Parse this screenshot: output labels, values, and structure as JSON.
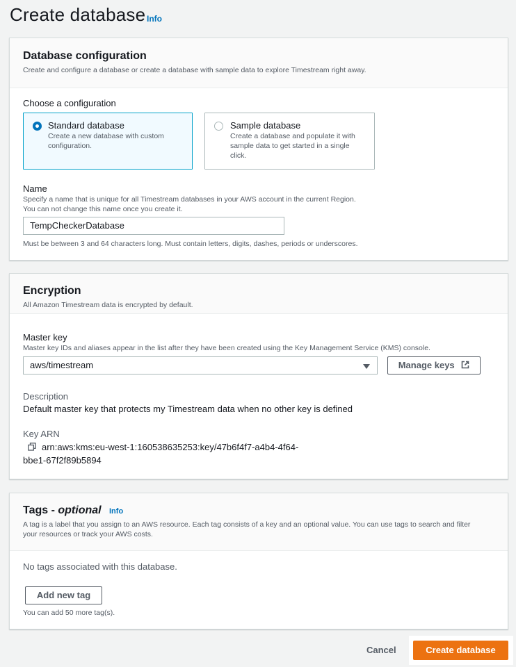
{
  "page": {
    "title": "Create database",
    "info": "Info"
  },
  "db_config": {
    "title": "Database configuration",
    "description": "Create and configure a database or create a database with sample data to explore Timestream right away.",
    "choose_label": "Choose a configuration",
    "options": [
      {
        "title": "Standard database",
        "desc_line1": "Create a new database with custom",
        "desc_line2": "configuration.",
        "selected": true
      },
      {
        "title": "Sample database",
        "desc_line1": "Create a database and populate it with",
        "desc_line2": "sample data to get started in a single",
        "desc_line3": "click.",
        "selected": false
      }
    ],
    "name_label": "Name",
    "name_desc_line1": "Specify a name that is unique for all Timestream databases in your AWS account in the current Region.",
    "name_desc_line2": "You can not change this name once you create it.",
    "name_value": "TempCheckerDatabase",
    "name_constraint": "Must be between 3 and 64 characters long. Must contain letters, digits, dashes, periods or underscores."
  },
  "encryption": {
    "title": "Encryption",
    "description": "All Amazon Timestream data is encrypted by default.",
    "master_key_label": "Master key",
    "master_key_desc": "Master key IDs and aliases appear in the list after they have been created using the Key Management Service (KMS) console.",
    "master_key_value": "aws/timestream",
    "manage_keys": "Manage keys",
    "description_label": "Description",
    "description_value": "Default master key that protects my Timestream data when no other key is defined",
    "arn_label": "Key ARN",
    "arn_line1": "arn:aws:kms:eu-west-1:160538635253:key/47b6f4f7-a4b4-4f64-",
    "arn_line2": "bbe1-67f2f89b5894"
  },
  "tags": {
    "title_main": "Tags - ",
    "title_optional": "optional",
    "info": "Info",
    "desc_line1": "A tag is a label that you assign to an AWS resource. Each tag consists of a key and an optional value. You can use tags to search and filter",
    "desc_line2": "your resources or track your AWS costs.",
    "empty": "No tags associated with this database.",
    "add_button": "Add new tag",
    "remaining": "You can add 50 more tag(s)."
  },
  "footer": {
    "cancel": "Cancel",
    "create": "Create database"
  },
  "colors": {
    "primary": "#ec7211",
    "link": "#0073bb",
    "selected_border": "#00a1c9"
  }
}
